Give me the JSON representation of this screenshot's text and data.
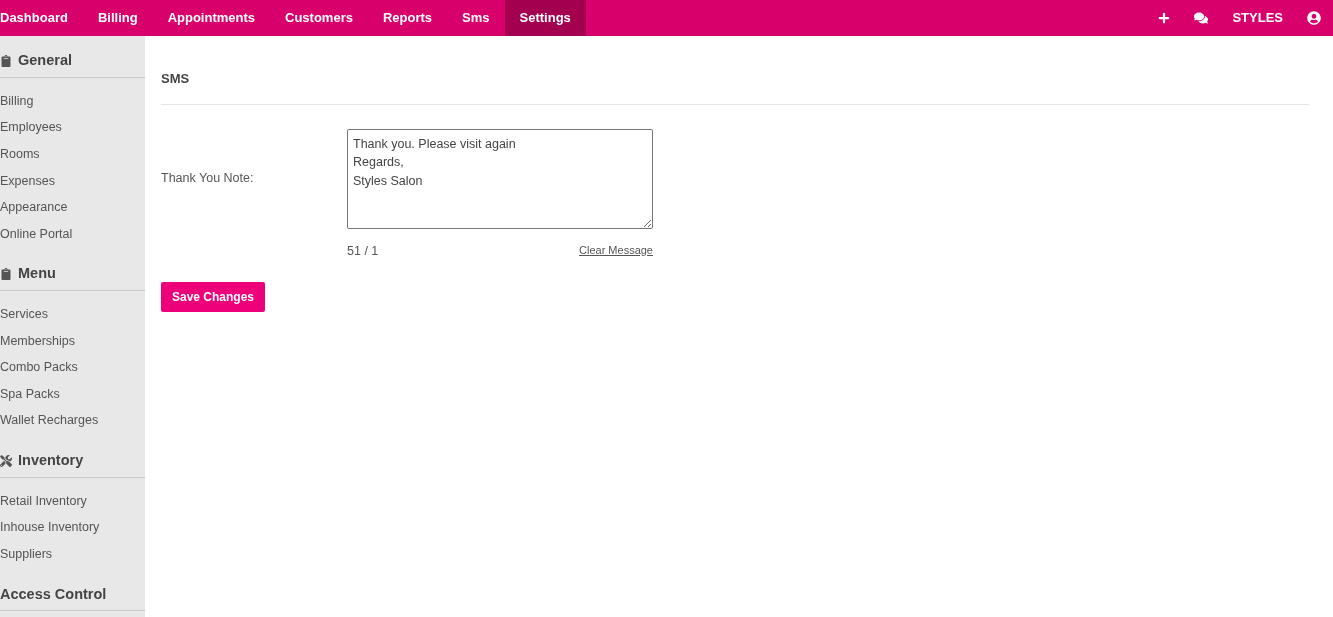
{
  "nav": {
    "items": [
      {
        "label": "Dashboard",
        "selected": false
      },
      {
        "label": "Billing",
        "selected": false
      },
      {
        "label": "Appointments",
        "selected": false
      },
      {
        "label": "Customers",
        "selected": false
      },
      {
        "label": "Reports",
        "selected": false
      },
      {
        "label": "Sms",
        "selected": false
      },
      {
        "label": "Settings",
        "selected": true
      }
    ],
    "account": "STYLES"
  },
  "sidebar": {
    "sections": [
      {
        "title": "General",
        "kind": "clipboard",
        "items": [
          "Billing",
          "Employees",
          "Rooms",
          "Expenses",
          "Appearance",
          "Online Portal"
        ]
      },
      {
        "title": "Menu",
        "kind": "clipboard",
        "items": [
          "Services",
          "Memberships",
          "Combo Packs",
          "Spa Packs",
          "Wallet Recharges"
        ]
      },
      {
        "title": "Inventory",
        "kind": "tools",
        "items": [
          "Retail Inventory",
          "Inhouse Inventory",
          "Suppliers"
        ]
      },
      {
        "title": "Access Control",
        "kind": "plain"
      }
    ]
  },
  "content": {
    "title": "SMS",
    "field_label": "Thank You Note:",
    "message": "Thank you. Please visit again\nRegards,\nStyles Salon",
    "counter": "51 / 1",
    "clear_link": "Clear Message",
    "save_button": "Save Changes"
  }
}
